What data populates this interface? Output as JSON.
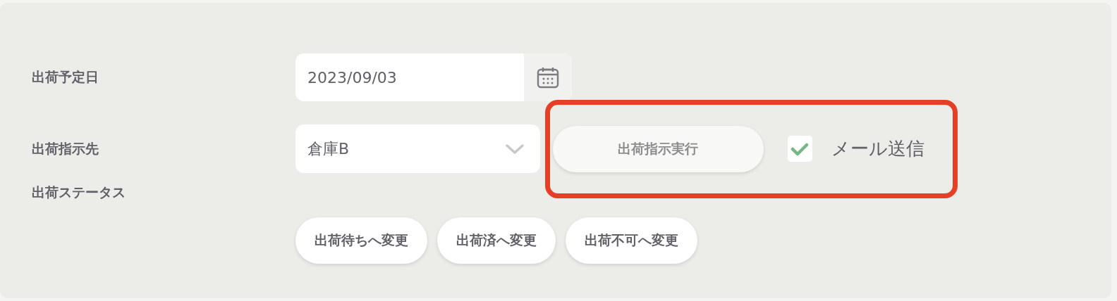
{
  "ship_date": {
    "label": "出荷予定日",
    "value": "2023/09/03"
  },
  "destination": {
    "label": "出荷指示先",
    "value": "倉庫B"
  },
  "execute_button": {
    "label": "出荷指示実行",
    "disabled": true
  },
  "mail_checkbox": {
    "label": "メール送信",
    "checked": true
  },
  "highlight": {
    "on": true
  },
  "status": {
    "label": "出荷ステータス",
    "buttons": [
      {
        "label": "出荷待ちへ変更"
      },
      {
        "label": "出荷済へ変更"
      },
      {
        "label": "出荷不可へ変更"
      }
    ]
  }
}
